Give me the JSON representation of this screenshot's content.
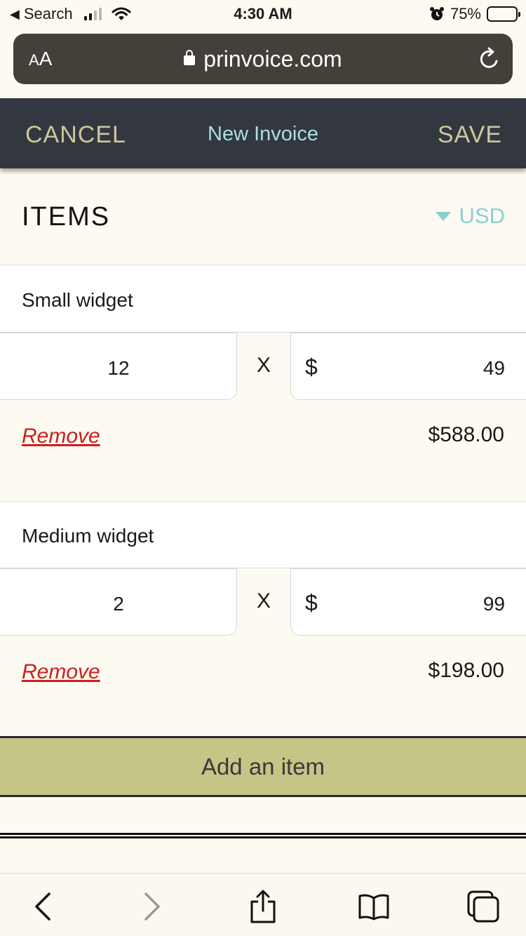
{
  "status_bar": {
    "back_app": "Search",
    "time": "4:30 AM",
    "battery": "75%",
    "battery_level": 0.75
  },
  "browser": {
    "text_size_label_small": "A",
    "text_size_label_large": "A",
    "url": "prinvoice.com"
  },
  "header": {
    "cancel_label": "CANCEL",
    "title": "New Invoice",
    "save_label": "SAVE"
  },
  "items_section": {
    "title": "ITEMS",
    "currency": "USD"
  },
  "items": [
    {
      "name": "Small widget",
      "quantity": "12",
      "times": "X",
      "currency_symbol": "$",
      "price": "49",
      "remove_label": "Remove",
      "total": "$588.00"
    },
    {
      "name": "Medium widget",
      "quantity": "2",
      "times": "X",
      "currency_symbol": "$",
      "price": "99",
      "remove_label": "Remove",
      "total": "$198.00"
    }
  ],
  "add_item_label": "Add an item",
  "toolbar_icons": [
    "back-icon",
    "forward-icon",
    "share-icon",
    "bookmarks-icon",
    "tabs-icon"
  ],
  "colors": {
    "header_bg": "#333840",
    "header_action": "#cfc79a",
    "header_title": "#a9dfe4",
    "accent": "#8ccfd3",
    "remove": "#cc1f1f",
    "add_button": "#c5c587",
    "page_bg": "#fdfaf1"
  }
}
